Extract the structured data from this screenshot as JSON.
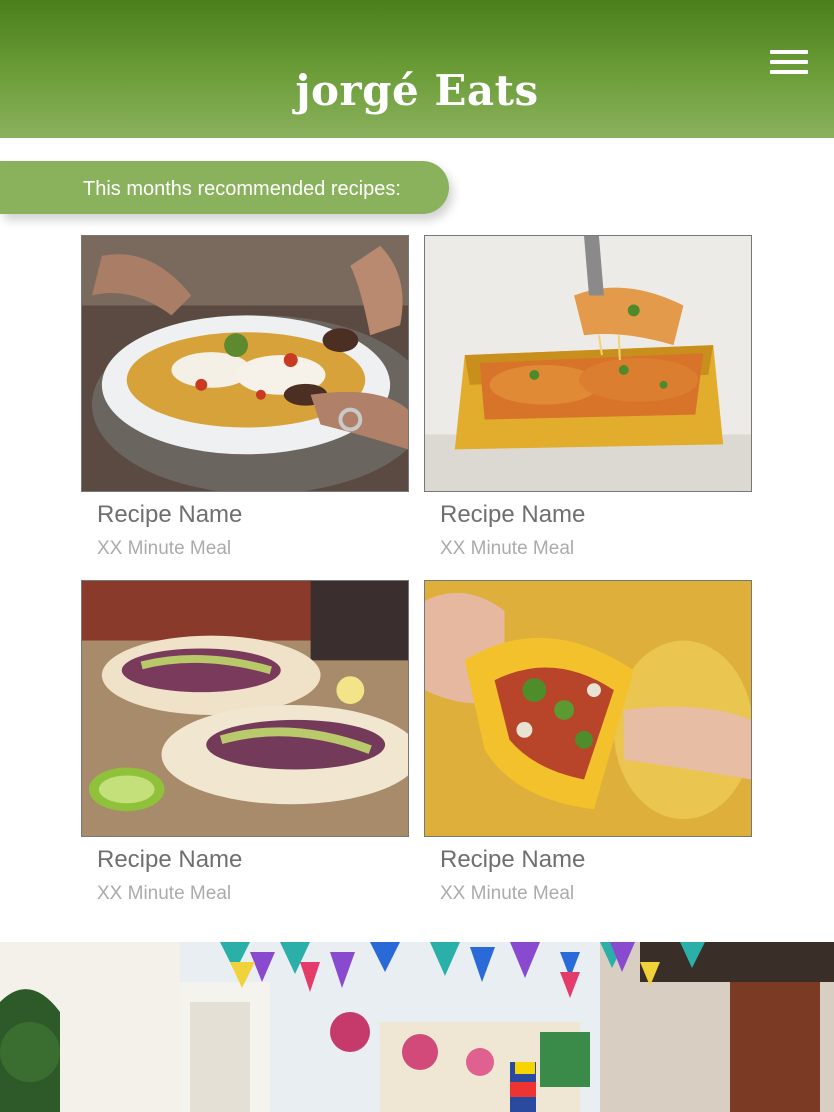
{
  "header": {
    "brand": "jorgé Eats",
    "menu_icon": "hamburger-menu-icon",
    "colors": {
      "top": "#4a7f1c",
      "bottom": "#8bb15e"
    }
  },
  "banner": {
    "text": "This months recommended recipes:",
    "color": "#8ab25d"
  },
  "recipes": [
    {
      "name": "Recipe Name",
      "meta": "XX Minute Meal",
      "image": "nachos-plate-photo"
    },
    {
      "name": "Recipe Name",
      "meta": "XX Minute Meal",
      "image": "enchiladas-dish-photo"
    },
    {
      "name": "Recipe Name",
      "meta": "XX Minute Meal",
      "image": "tacos-lime-photo"
    },
    {
      "name": "Recipe Name",
      "meta": "XX Minute Meal",
      "image": "taco-in-hand-photo"
    }
  ],
  "hero": {
    "image": "colorful-street-bunting-photo"
  }
}
